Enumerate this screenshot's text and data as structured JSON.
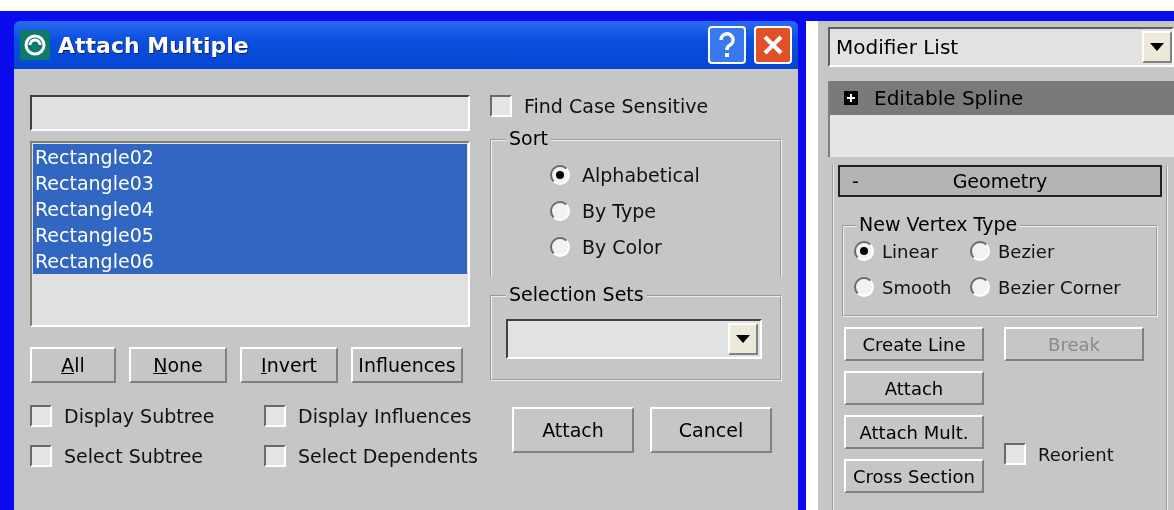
{
  "dialog": {
    "title": "Attach Multiple",
    "objects": [
      {
        "label": "Rectangle02",
        "selected": true
      },
      {
        "label": "Rectangle03",
        "selected": true
      },
      {
        "label": "Rectangle04",
        "selected": true
      },
      {
        "label": "Rectangle05",
        "selected": true
      },
      {
        "label": "Rectangle06",
        "selected": true
      }
    ],
    "list_buttons": [
      {
        "label": "All",
        "underline_first": true
      },
      {
        "label": "None",
        "underline_first": true
      },
      {
        "label": "Invert",
        "underline_first": true
      },
      {
        "label": "Influences",
        "underline_first": false
      }
    ],
    "options": [
      {
        "label": "Display Subtree",
        "checked": false
      },
      {
        "label": "Display Influences",
        "checked": false
      },
      {
        "label": "Select Subtree",
        "checked": false
      },
      {
        "label": "Select Dependents",
        "checked": false
      }
    ],
    "find_case_sensitive": {
      "label": "Find Case Sensitive",
      "checked": false
    },
    "sort": {
      "title": "Sort",
      "options": [
        {
          "label": "Alphabetical",
          "selected": true
        },
        {
          "label": "By Type",
          "selected": false
        },
        {
          "label": "By Color",
          "selected": false
        }
      ]
    },
    "selection_sets": {
      "title": "Selection Sets"
    },
    "buttons": [
      "Attach",
      "Cancel"
    ]
  },
  "modifier_panel": {
    "modifier_list": "Modifier List",
    "stack": [
      {
        "label": "Editable Spline",
        "selected": true
      }
    ],
    "rollout": {
      "title": "Geometry",
      "expander": "-"
    },
    "vertex_type": {
      "title": "New Vertex Type",
      "options": [
        {
          "label": "Linear",
          "selected": true
        },
        {
          "label": "Bezier",
          "selected": false
        },
        {
          "label": "Smooth",
          "selected": false
        },
        {
          "label": "Bezier Corner",
          "selected": false
        }
      ]
    },
    "buttons": [
      {
        "label": "Create Line",
        "disabled": false
      },
      {
        "label": "Break",
        "disabled": true
      },
      {
        "label": "Attach",
        "disabled": false
      },
      {
        "label": "Attach Mult.",
        "disabled": false
      },
      {
        "label": "Cross Section",
        "disabled": false
      }
    ],
    "reorient": {
      "label": "Reorient",
      "checked": false
    }
  }
}
